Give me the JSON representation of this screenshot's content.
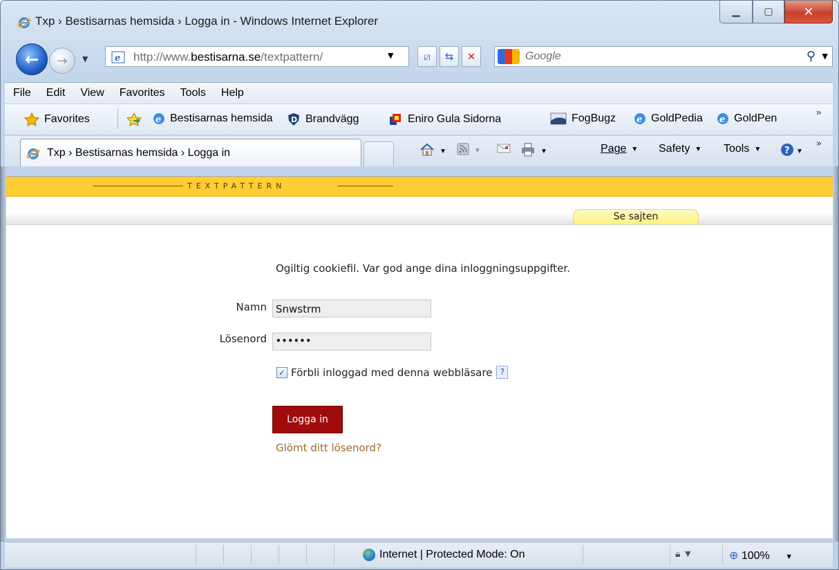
{
  "window": {
    "title": "Txp › Bestisarnas hemsida › Logga in - Windows Internet Explorer"
  },
  "address": {
    "url_prefix": "http://www.",
    "url_domain": "bestisarna.se",
    "url_path": "/textpattern/"
  },
  "search": {
    "placeholder": "Google"
  },
  "menu": [
    "File",
    "Edit",
    "View",
    "Favorites",
    "Tools",
    "Help"
  ],
  "favorites_bar": {
    "favorites_label": "Favorites",
    "items": [
      "Bestisarnas hemsida",
      "Brandvägg",
      "Eniro Gula Sidorna",
      "FogBugz",
      "GoldPedia",
      "GoldPen"
    ]
  },
  "tab": {
    "title": "Txp › Bestisarnas hemsida › Logga in"
  },
  "command_bar": {
    "page": "Page",
    "safety": "Safety",
    "tools": "Tools"
  },
  "page": {
    "brand": "TEXTPATTERN",
    "view_site_tab": "Se sajten",
    "message": "Ogiltig cookiefil. Var god ange dina inloggningsuppgifter.",
    "name_label": "Namn",
    "name_value": "Snwstrm",
    "password_label": "Lösenord",
    "password_value": "••••••",
    "remember_label": "Förbli inloggad med denna webbläsare",
    "remember_checked": true,
    "help_symbol": "?",
    "login_button": "Logga in",
    "forgot_link": "Glömt ditt lösenord?"
  },
  "status_bar": {
    "zone": "Internet | Protected Mode: On",
    "zoom": "100%"
  },
  "colors": {
    "txp_yellow": "#ffcc33",
    "login_button": "#a00c0c",
    "link": "#9a6b2a"
  }
}
